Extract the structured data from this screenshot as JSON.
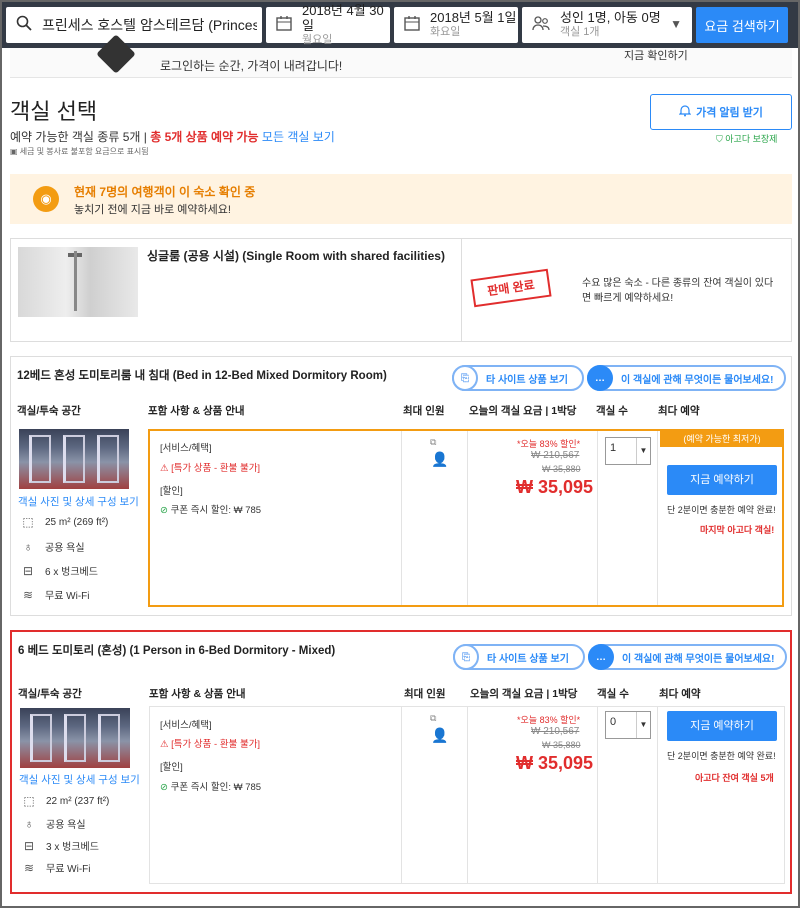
{
  "topbar": {
    "search_text": "프린세스 호스텔 암스테르담 (Princess Hostel",
    "checkin_date": "2018년 4월 30일",
    "checkin_day": "월요일",
    "checkout_date": "2018년 5월 1일",
    "checkout_day": "화요일",
    "guests": "성인 1명, 아동 0명",
    "rooms": "객실 1개",
    "search_button": "요금 검색하기"
  },
  "login_strip": {
    "text": "로그인하는 순간, 가격이 내려갑니다!",
    "right_text": "지금 확인하기"
  },
  "section": {
    "title": "객실 선택",
    "summary_prefix": "예약 가능한 객실 종류 5개 |",
    "summary_red": "총 5개 상품 예약 가능",
    "summary_link": "모든 객실 보기",
    "tax_note": "세금 및 봉사료 불포함 요금으로 표시됨",
    "alert_button": "가격 알림 받기",
    "guarantee": "아고다 보장제"
  },
  "viewers": {
    "headline": "현재 7명의 여행객이 이 숙소 확인 중",
    "subtext": "놓치기 전에 지금 바로 예약하세요!"
  },
  "sold_out_room": {
    "name": "싱글룸 (공용 시설) (Single Room with shared facilities)",
    "stamp": "판매 완료",
    "note": "수요 많은 숙소 - 다른 종류의 잔여 객실이 있다면 빠르게 예약하세요!"
  },
  "headers": {
    "room_type": "객실/투숙 공간",
    "includes": "포함 사항 & 상품 안내",
    "max_guests": "최대 인원",
    "price_today": "오늘의 객실 요금 | 1박당",
    "rooms": "객실 수",
    "best_book": "최다 예약"
  },
  "common": {
    "external_link": "타 사이트 상품 보기",
    "ask": "이 객실에 관해 무엇이든 물어보세요!",
    "photos_link": "객실 사진 및 상세 구성 보기",
    "service_label": "[서비스/혜택]",
    "nonrefund": "[특가 상품 - 환불 불가]",
    "discount_label": "[할인]",
    "coupon": "쿠폰 즉시 할인: ₩ 785",
    "book_button": "지금 예약하기",
    "enough_note": "단 2분이면 충분한 예약 완료!"
  },
  "rooms": [
    {
      "title": "12베드 혼성 도미토리룸 내 침대 (Bed in 12-Bed Mixed Dormitory Room)",
      "size": "25 m² (269 ft²)",
      "bath": "공용 욕실",
      "beds": "6 x 벙크베드",
      "wifi": "무료 Wi-Fi",
      "promo": "*오늘 83% 할인*",
      "orig_price": "₩ 210,567",
      "mid_price": "₩ 35,880",
      "price": "₩ 35,095",
      "qty": "1",
      "best_tag": "(예약 가능한 최저가)",
      "last_note": "마지막 아고다 객실!"
    },
    {
      "title": "6 베드 도미토리 (혼성) (1 Person in 6-Bed Dormitory - Mixed)",
      "size": "22 m² (237 ft²)",
      "bath": "공용 욕실",
      "beds": "3 x 벙크베드",
      "wifi": "무료 Wi-Fi",
      "promo": "*오늘 83% 할인*",
      "orig_price": "₩ 210,567",
      "mid_price": "₩ 35,880",
      "price": "₩ 35,095",
      "qty": "0",
      "last_note": "아고다 잔여 객실 5개"
    }
  ]
}
